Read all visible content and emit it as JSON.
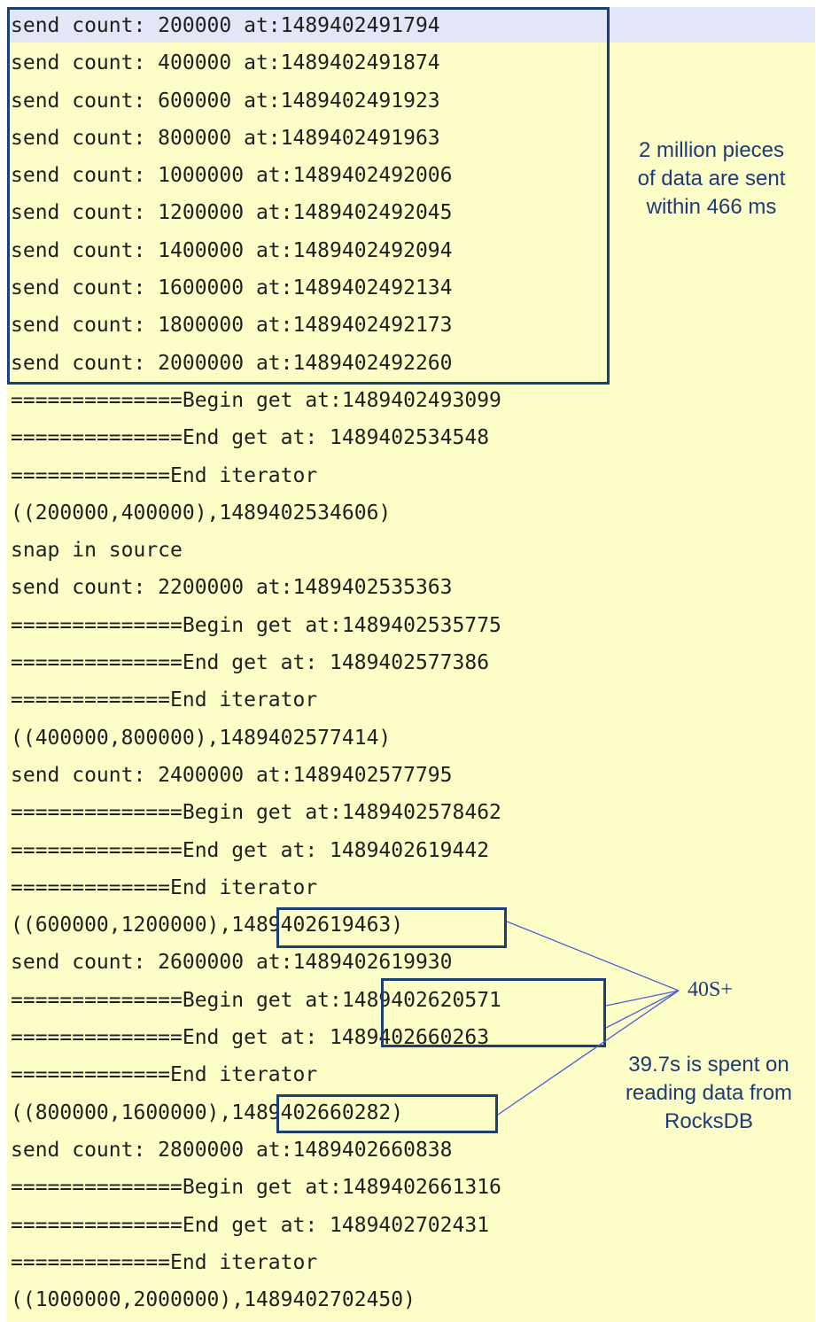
{
  "log_lines": [
    "send count: 200000 at:1489402491794",
    "send count: 400000 at:1489402491874",
    "send count: 600000 at:1489402491923",
    "send count: 800000 at:1489402491963",
    "send count: 1000000 at:1489402492006",
    "send count: 1200000 at:1489402492045",
    "send count: 1400000 at:1489402492094",
    "send count: 1600000 at:1489402492134",
    "send count: 1800000 at:1489402492173",
    "send count: 2000000 at:1489402492260",
    "==============Begin get at:1489402493099",
    "==============End get at: 1489402534548",
    "=============End iterator",
    "((200000,400000),1489402534606)",
    "snap in source",
    "send count: 2200000 at:1489402535363",
    "==============Begin get at:1489402535775",
    "==============End get at: 1489402577386",
    "=============End iterator",
    "((400000,800000),1489402577414)",
    "send count: 2400000 at:1489402577795",
    "==============Begin get at:1489402578462",
    "==============End get at: 1489402619442",
    "=============End iterator",
    "((600000,1200000),1489402619463)",
    "send count: 2600000 at:1489402619930",
    "==============Begin get at:1489402620571",
    "==============End get at: 1489402660263",
    "=============End iterator",
    "((800000,1600000),1489402660282)",
    "send count: 2800000 at:1489402660838",
    "==============Begin get at:1489402661316",
    "==============End get at: 1489402702431",
    "=============End iterator",
    "((1000000,2000000),1489402702450)"
  ],
  "annotations": {
    "send_summary": "2 million pieces of data are sent within 466 ms",
    "interval_label": "40S+",
    "read_summary": "39.7s is spent on reading data from RocksDB"
  },
  "colors": {
    "background": "#fdfdc8",
    "annotation": "#1c3f73",
    "connector": "#4a5fd6",
    "highlight": "#e3e6f6"
  }
}
